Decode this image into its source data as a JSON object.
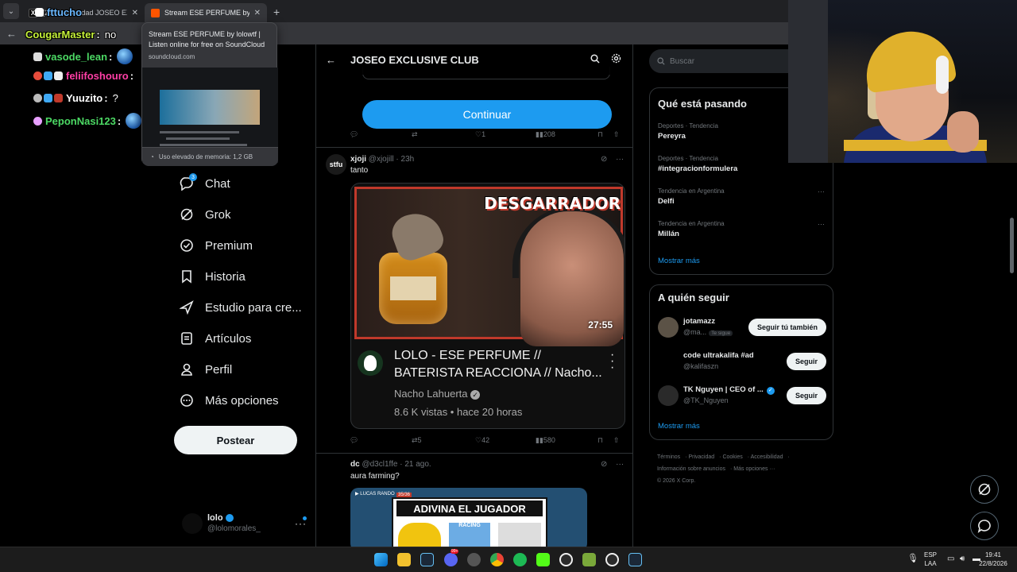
{
  "browser": {
    "tabs": [
      {
        "title": "(23) Comunidad JOSEO EXCLUS",
        "active": false,
        "favicon": "x-logo"
      },
      {
        "title": "Stream ESE PERFUME by lolowtf",
        "active": true,
        "favicon": "soundcloud-logo"
      }
    ],
    "new_tab": "+",
    "tab_close": "✕"
  },
  "tooltip": {
    "title": "Stream ESE PERFUME by lolowtf | Listen online for free on SoundCloud",
    "domain": "soundcloud.com",
    "memory": "Uso elevado de memoria: 1,2 GB"
  },
  "stream_chat": [
    {
      "user": "CougarMaster",
      "message": "no",
      "color": "#c6f23a"
    },
    {
      "user": "vasode_lean",
      "message": "",
      "color": "#4cd964"
    },
    {
      "user": "feliifoshouro",
      "message": "",
      "color": "#ff3fa6"
    },
    {
      "user": "Yuuzito",
      "message": "?",
      "color": "#ffffff"
    },
    {
      "user": "PeponNasi123",
      "message": "",
      "color": "#4cd964"
    },
    {
      "user": "fttucho",
      "message": "",
      "color": "#6ab8ff"
    }
  ],
  "nav": {
    "items": [
      {
        "label": "Chat",
        "icon": "chat-icon"
      },
      {
        "label": "Grok",
        "icon": "grok-icon"
      },
      {
        "label": "Premium",
        "icon": "premium-icon"
      },
      {
        "label": "Historia",
        "icon": "bookmark-icon"
      },
      {
        "label": "Estudio para cre...",
        "icon": "rocket-icon"
      },
      {
        "label": "Artículos",
        "icon": "article-icon"
      },
      {
        "label": "Perfil",
        "icon": "person-icon"
      },
      {
        "label": "Más opciones",
        "icon": "more-circle-icon"
      }
    ],
    "chat_badge": "3",
    "post_button": "Postear",
    "profile": {
      "name": "lolo",
      "handle": "@lolomorales_",
      "more": "···"
    }
  },
  "header": {
    "title": "JOSEO EXCLUSIVE CLUB"
  },
  "feed": {
    "continue_button": "Continuar",
    "first_actions": {
      "reply": "",
      "repost": "",
      "like": "1",
      "views": "208"
    },
    "tweets": [
      {
        "avatar_text": "stfu",
        "name": "xjoji",
        "handle": "@xjojill",
        "time": "23h",
        "text": "tanto",
        "video": {
          "overlay_title": "DESGARRADOR",
          "duration": "27:55",
          "title": "LOLO - ESE PERFUME // BATERISTA REACCIONA // Nacho...",
          "channel": "Nacho Lahuerta",
          "meta": "8.6 K vistas • hace 20 horas"
        },
        "actions": {
          "reply": "",
          "repost": "5",
          "like": "42",
          "views": "580"
        }
      },
      {
        "name": "dc",
        "handle": "@d3cl1ffe",
        "time": "21 ago.",
        "text": "aura farming?",
        "image": {
          "banner": "ADIVINA EL JUGADOR",
          "counter": "35/36",
          "club": "RACING"
        }
      }
    ]
  },
  "right": {
    "search_placeholder": "Buscar",
    "trends_title": "Qué está pasando",
    "trends": [
      {
        "context": "Deportes · Tendencia",
        "name": "Pereyra",
        "more": false
      },
      {
        "context": "Deportes · Tendencia",
        "name": "#integracionformulera",
        "more": false
      },
      {
        "context": "Tendencia en Argentina",
        "name": "Delfi",
        "more": true
      },
      {
        "context": "Tendencia en Argentina",
        "name": "Millán",
        "more": true
      }
    ],
    "trends_more": "Mostrar más",
    "follow_title": "A quién seguir",
    "follow": [
      {
        "name": "jotamazz",
        "handle": "@ma...",
        "follows_you": "Te sigue",
        "button": "Seguir tú también",
        "verified": false
      },
      {
        "name": "code ultrakalifa #ad",
        "handle": "@kalifaszn",
        "follows_you": "",
        "button": "Seguir",
        "verified": false
      },
      {
        "name": "TK Nguyen | CEO of ...",
        "handle": "@TK_Nguyen",
        "follows_you": "",
        "button": "Seguir",
        "verified": true
      }
    ],
    "follow_more": "Mostrar más",
    "footer": [
      "Términos",
      "Privacidad",
      "Cookies",
      "Accesibilidad",
      "Información sobre anuncios",
      "Más opciones ···",
      "© 2026 X Corp."
    ]
  },
  "taskbar": {
    "lang": "ESP",
    "layout": "LAA",
    "time": "19:41",
    "date": "22/8/2026",
    "discord_badge": "99+"
  },
  "colors": {
    "accent": "#1d9bf0",
    "background": "#000000",
    "soundcloud": "#ff5500"
  }
}
